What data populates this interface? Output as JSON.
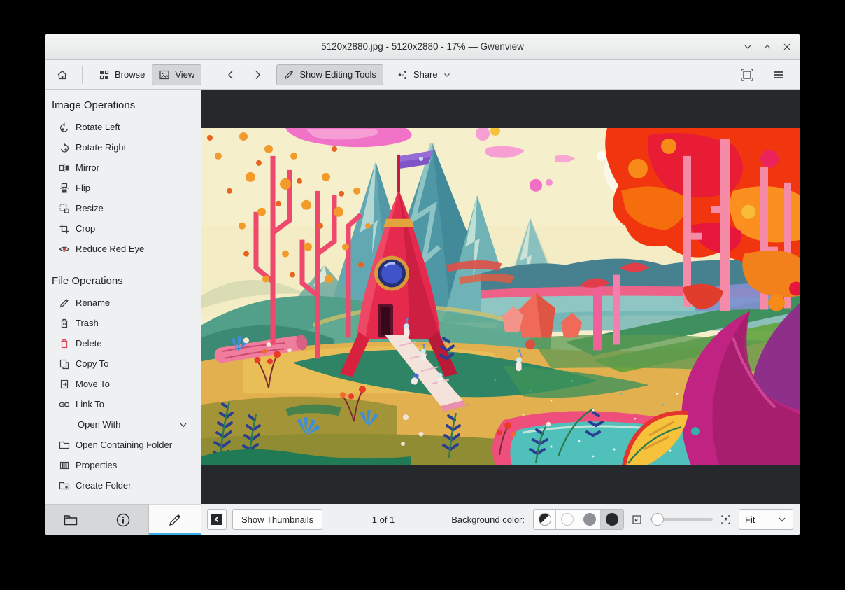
{
  "window": {
    "title": "5120x2880.jpg - 5120x2880 - 17% — Gwenview"
  },
  "toolbar": {
    "browse_label": "Browse",
    "view_label": "View",
    "editing_tools_label": "Show Editing Tools",
    "share_label": "Share"
  },
  "sidebar": {
    "image_ops_title": "Image Operations",
    "image_ops": [
      {
        "label": "Rotate Left"
      },
      {
        "label": "Rotate Right"
      },
      {
        "label": "Mirror"
      },
      {
        "label": "Flip"
      },
      {
        "label": "Resize"
      },
      {
        "label": "Crop"
      },
      {
        "label": "Reduce Red Eye"
      }
    ],
    "file_ops_title": "File Operations",
    "file_ops": [
      {
        "label": "Rename"
      },
      {
        "label": "Trash"
      },
      {
        "label": "Delete"
      },
      {
        "label": "Copy To"
      },
      {
        "label": "Move To"
      },
      {
        "label": "Link To"
      },
      {
        "label": "Open With"
      },
      {
        "label": "Open Containing Folder"
      },
      {
        "label": "Properties"
      },
      {
        "label": "Create Folder"
      }
    ]
  },
  "statusbar": {
    "show_thumbnails_label": "Show Thumbnails",
    "count": "1 of 1",
    "background_color_label": "Background color:",
    "zoom_mode": "Fit"
  },
  "colors": {
    "accent": "#3daee9",
    "delete_red": "#da4453",
    "view_background": "#26292c"
  }
}
